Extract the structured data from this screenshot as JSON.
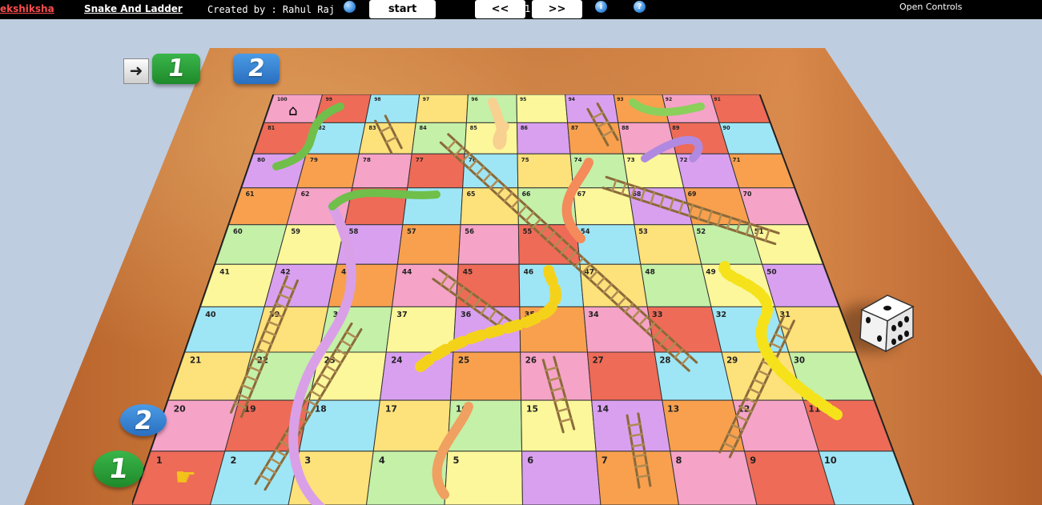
{
  "header": {
    "brand": "ekshiksha",
    "game_title": "Snake And Ladder",
    "credit": "Created by : Rahul Raj",
    "start_label": "start",
    "prev_label": "<<",
    "next_label": ">>",
    "history_index": "1",
    "info_icon": "i",
    "help_icon": "?",
    "open_controls": "Open Controls"
  },
  "players": {
    "current_turn_icon": "arrow-right-icon",
    "player1_label": "1",
    "player2_label": "2"
  },
  "board": {
    "rows": [
      [
        "100",
        "99",
        "98",
        "97",
        "96",
        "95",
        "94",
        "93",
        "92",
        "91"
      ],
      [
        "81",
        "82",
        "83",
        "84",
        "85",
        "86",
        "87",
        "88",
        "89",
        "90"
      ],
      [
        "80",
        "79",
        "78",
        "77",
        "76",
        "75",
        "74",
        "73",
        "72",
        "71"
      ],
      [
        "61",
        "62",
        "63",
        "64",
        "65",
        "66",
        "67",
        "68",
        "69",
        "70"
      ],
      [
        "60",
        "59",
        "58",
        "57",
        "56",
        "55",
        "54",
        "53",
        "52",
        "51"
      ],
      [
        "41",
        "42",
        "43",
        "44",
        "45",
        "46",
        "47",
        "48",
        "49",
        "50"
      ],
      [
        "40",
        "39",
        "38",
        "37",
        "36",
        "35",
        "34",
        "33",
        "32",
        "31"
      ],
      [
        "21",
        "22",
        "23",
        "24",
        "25",
        "26",
        "27",
        "28",
        "29",
        "30"
      ],
      [
        "20",
        "19",
        "18",
        "17",
        "16",
        "15",
        "14",
        "13",
        "12",
        "11"
      ],
      [
        "1",
        "2",
        "3",
        "4",
        "5",
        "6",
        "7",
        "8",
        "9",
        "10"
      ]
    ],
    "start_cell_icon": "pointing-hand-icon",
    "home_cell_icon": "house-icon"
  },
  "colors": {
    "board_palette": [
      "#f5a3c7",
      "#fbf79a",
      "#9ee6f5",
      "#f8a04e",
      "#c4f0a8",
      "#ee6b57",
      "#d9a0f0",
      "#fde17a"
    ],
    "table_wood": "#c9733a",
    "background": "#bfcde0"
  },
  "dice": {
    "value": "3"
  }
}
